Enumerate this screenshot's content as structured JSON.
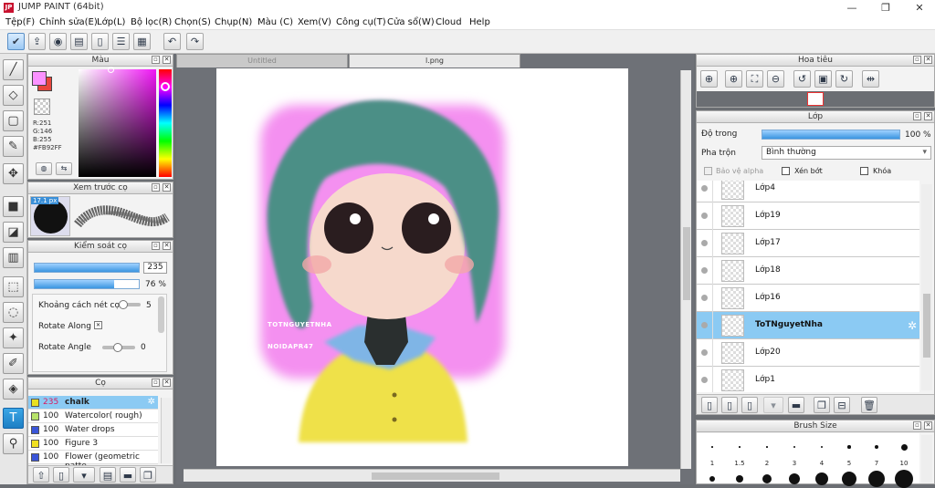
{
  "window": {
    "title": "JUMP PAINT (64bit)",
    "logo": "JP",
    "min": "—",
    "max": "❐",
    "close": "✕"
  },
  "menu": [
    "Tệp(F)",
    "Chỉnh sửa(E)",
    "Lớp(L)",
    "Bộ lọc(R)",
    "Chọn(S)",
    "Chụp(N)",
    "Màu (C)",
    "Xem(V)",
    "Công cụ(T)",
    "Cửa sổ(W)",
    "Cloud",
    "Help"
  ],
  "toolbar_icons": [
    "check-icon",
    "share-icon",
    "comment-icon",
    "message-icon",
    "document-icon",
    "list-icon",
    "grid-edit-icon",
    "undo-icon",
    "redo-icon"
  ],
  "tools": [
    "brush-icon",
    "eraser-icon",
    "rectangle-select-icon",
    "pen-icon",
    "move-icon",
    "fill-rect-icon",
    "bucket-icon",
    "gradient-icon",
    "dotted-select-icon",
    "lasso-icon",
    "magic-wand-icon",
    "select-pen-icon",
    "select-eraser-icon",
    "text-icon",
    "eyedropper-icon"
  ],
  "color_panel": {
    "title": "Màu",
    "r": "R:251",
    "g": "G:146",
    "b": "B:255",
    "hex": "#FB92FF",
    "primary": "#FB92FF",
    "secondary": "#E8453C"
  },
  "preview_panel": {
    "title": "Xem trước cọ",
    "size_badge": "17.1 px"
  },
  "brush_control": {
    "title": "Kiểm soát cọ",
    "size_value": "235",
    "opacity_value": "76 %",
    "spacing_label": "Khoảng cách nét cọ",
    "spacing_value": "5",
    "rotate_along_label": "Rotate Along",
    "rotate_angle_label": "Rotate Angle",
    "rotate_angle_value": "0"
  },
  "brush_panel": {
    "title": "Cọ",
    "items": [
      {
        "size": "235",
        "name": "chalk",
        "color": "#e8e020"
      },
      {
        "size": "100",
        "name": "Watercolor( rough)",
        "color": "#b7e36a"
      },
      {
        "size": "100",
        "name": "Water drops",
        "color": "#3a55d8"
      },
      {
        "size": "100",
        "name": "Figure 3",
        "color": "#f0e020"
      },
      {
        "size": "100",
        "name": "Flower (geometric patte",
        "color": "#3a55d8"
      }
    ]
  },
  "tabs": [
    {
      "label": "Untitled"
    },
    {
      "label": "l.png"
    }
  ],
  "canvas_text": {
    "line1": "TOTNGUYETNHA",
    "line2": "NOIDAPR47"
  },
  "navigator": {
    "title": "Hoa tiêu"
  },
  "layer_panel": {
    "title": "Lớp",
    "opacity_label": "Độ trong",
    "opacity_value": "100 %",
    "blend_label": "Pha trộn",
    "blend_value": "Bình thường",
    "protect_alpha": "Bảo vệ alpha",
    "clipping": "Xén bớt",
    "lock": "Khóa",
    "layers": [
      {
        "name": "Lớp4",
        "selected": false
      },
      {
        "name": "Lớp19",
        "selected": false
      },
      {
        "name": "Lớp17",
        "selected": false
      },
      {
        "name": "Lớp18",
        "selected": false
      },
      {
        "name": "Lớp16",
        "selected": false
      },
      {
        "name": "ToTNguyetNha",
        "selected": true
      },
      {
        "name": "Lớp20",
        "selected": false
      },
      {
        "name": "Lớp1",
        "selected": false
      }
    ]
  },
  "brush_size": {
    "title": "Brush Size",
    "sizes": [
      "1",
      "1.5",
      "2",
      "3",
      "4",
      "5",
      "7",
      "10"
    ]
  }
}
